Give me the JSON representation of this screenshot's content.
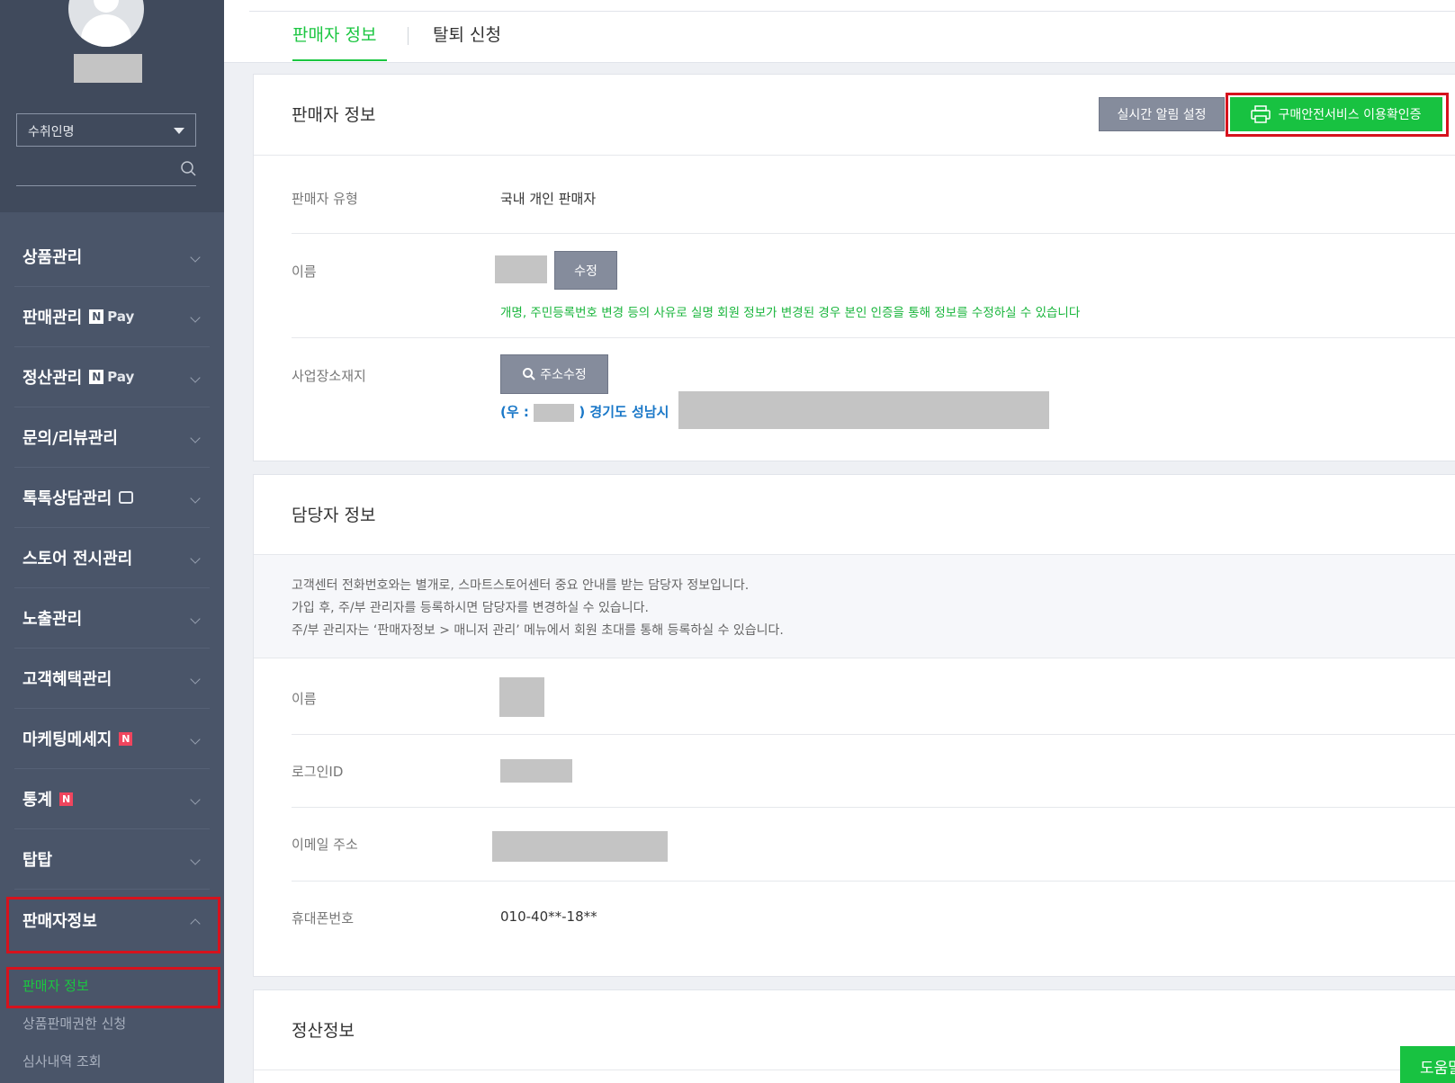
{
  "sidebar": {
    "store_select": "수취인명",
    "menu": [
      {
        "label": "상품관리"
      },
      {
        "label": "판매관리",
        "badge": "Pay"
      },
      {
        "label": "정산관리",
        "badge": "Pay"
      },
      {
        "label": "문의/리뷰관리"
      },
      {
        "label": "톡톡상담관리"
      },
      {
        "label": "스토어 전시관리"
      },
      {
        "label": "노출관리"
      },
      {
        "label": "고객혜택관리"
      },
      {
        "label": "마케팅메세지",
        "badge": "N"
      },
      {
        "label": "통계",
        "badge": "N"
      },
      {
        "label": "탑탑"
      },
      {
        "label": "판매자정보"
      }
    ],
    "npay_n": "N",
    "submenu": [
      {
        "label": "판매자 정보"
      },
      {
        "label": "상품판매권한 신청"
      },
      {
        "label": "심사내역 조회"
      }
    ]
  },
  "tabs": [
    {
      "label": "판매자 정보"
    },
    {
      "label": "탈퇴 신청"
    }
  ],
  "seller_card": {
    "title": "판매자 정보",
    "alarm_button": "실시간 알림 설정",
    "safe_service_button": "구매안전서비스 이용확인증",
    "type_label": "판매자 유형",
    "type_value": "국내 개인 판매자",
    "name_label": "이름",
    "edit_button": "수정",
    "name_note": "개명, 주민등록번호 변경 등의 사유로 실명 회원 정보가 변경된 경우 본인 인증을 통해 정보를 수정하실 수 있습니다",
    "address_label": "사업장소재지",
    "address_button": "주소수정",
    "address_prefix": "(우 :",
    "address_suffix": ") 경기도 성남시"
  },
  "manager_card": {
    "title": "담당자 정보",
    "info_lines": [
      "고객센터 전화번호와는 별개로, 스마트스토어센터 중요 안내를 받는 담당자 정보입니다.",
      "가입 후, 주/부 관리자를 등록하시면 담당자를 변경하실 수 있습니다.",
      "주/부 관리자는 ‘판매자정보 > 매니저 관리’ 메뉴에서 회원 초대를 통해 등록하실 수 있습니다."
    ],
    "name_label": "이름",
    "login_label": "로그인ID",
    "email_label": "이메일 주소",
    "phone_label": "휴대폰번호",
    "phone_value": "010-40**-18**"
  },
  "settlement_card": {
    "title": "정산정보"
  },
  "help_button": "도움말",
  "colors": {
    "sidebar": "#4a5569",
    "accent_green": "#18c241",
    "highlight_red": "#d6121d",
    "address_blue": "#1a78c8"
  }
}
